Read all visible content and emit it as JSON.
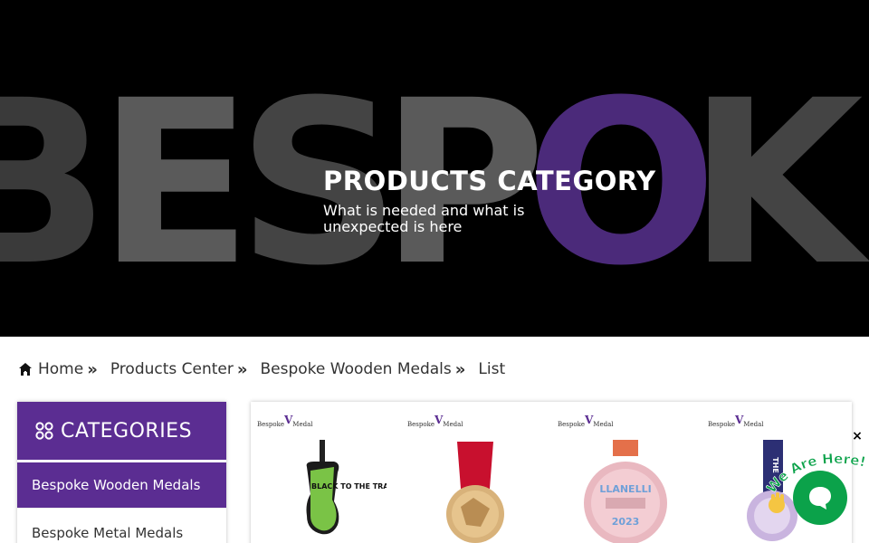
{
  "hero": {
    "background_word": "BESPOKE",
    "title": "PRODUCTS CATEGORY",
    "subtitle": "What is needed and what is unexpected is here"
  },
  "breadcrumb": {
    "items": [
      {
        "label": "Home",
        "icon": "home-icon"
      },
      {
        "label": "Products Center"
      },
      {
        "label": "Bespoke Wooden Medals"
      },
      {
        "label": "List"
      }
    ]
  },
  "sidebar": {
    "title": "CATEGORIES",
    "icon": "grid-icon",
    "items": [
      {
        "label": "Bespoke Wooden Medals",
        "active": true
      },
      {
        "label": "Bespoke Metal Medals",
        "active": false
      }
    ]
  },
  "products": {
    "brand_left": "Bespoke",
    "brand_right": "Medal",
    "items": [
      {
        "name": "BLACK TO THE TRAILS",
        "text": "BLACK TO THE TRAILS"
      },
      {
        "name": "wooden medal red ribbon",
        "text": ""
      },
      {
        "name": "LLANELLI 2023",
        "text": "LLANELLI",
        "year": "2023"
      },
      {
        "name": "wooden medal blue ribbon",
        "text": "THE"
      }
    ]
  },
  "chat": {
    "wave_text": "We Are Here!",
    "close": "×"
  },
  "colors": {
    "accent": "#5b2d92",
    "chat_green": "#0ba24a",
    "hero_bg": "#000000"
  }
}
